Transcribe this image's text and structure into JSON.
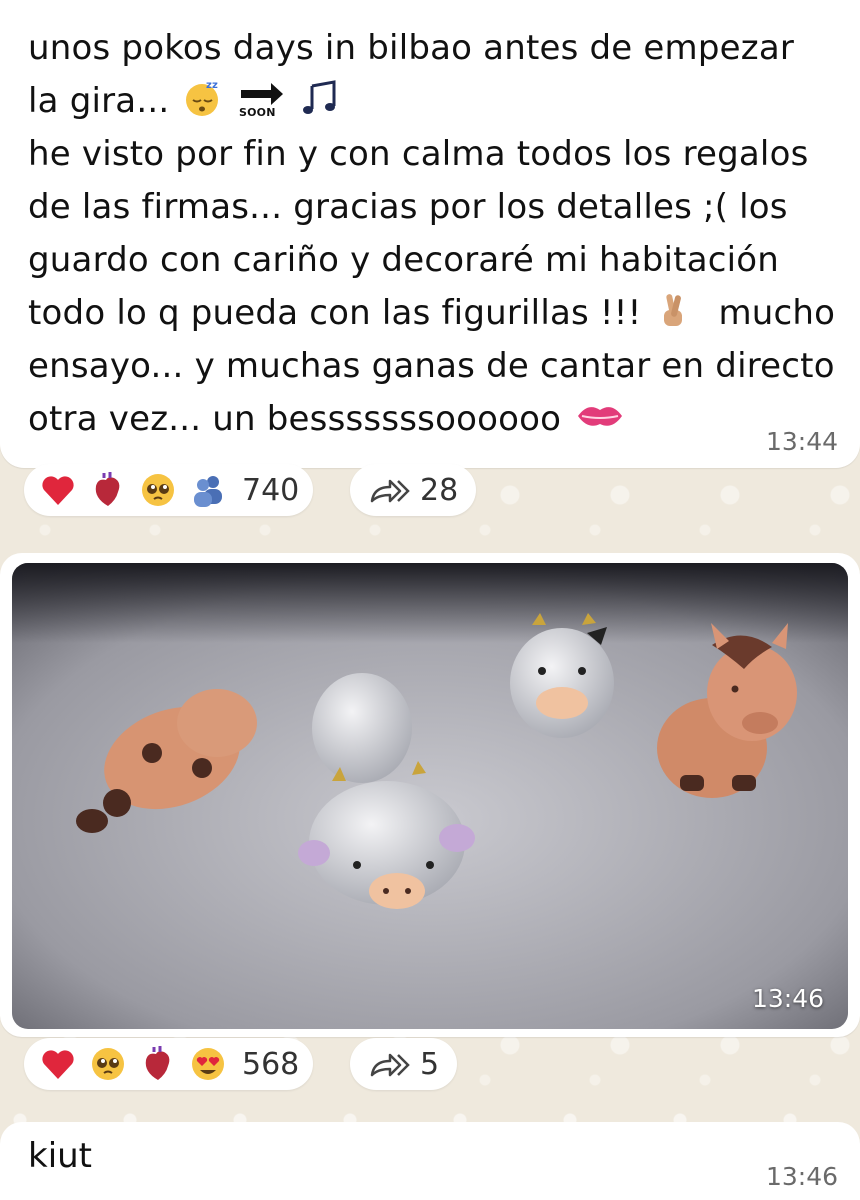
{
  "messages": [
    {
      "lines": [
        "unos pokos days in bilbao antes de empezar",
        "la gira...",
        "he visto por fin y con calma todos los regalos",
        "de las firmas... gracias por los detalles ;( los",
        "guardo con cariño y decoraré mi habitación",
        "todo lo q pueda con las figurillas !!!",
        "mucho",
        "ensayo... y muchas ganas de cantar en directo",
        "otra vez... un besssssssoooooo"
      ],
      "soon_label": "SOON",
      "time": "13:44",
      "reactions": [
        "red-heart",
        "anatomical-heart",
        "pleading-face",
        "busts-in-silhouette"
      ],
      "reaction_count": "740",
      "forward_count": "28"
    },
    {
      "type": "photo",
      "time": "13:46",
      "reactions": [
        "red-heart",
        "pleading-face",
        "anatomical-heart",
        "heart-eyes-face"
      ],
      "reaction_count": "568",
      "forward_count": "5"
    },
    {
      "text": "kiut",
      "time": "13:46"
    }
  ],
  "colors": {
    "wallpaper": "#efe9dd",
    "bubble": "#ffffff",
    "time": "#6a6a6a",
    "heart": "#e0263c"
  }
}
